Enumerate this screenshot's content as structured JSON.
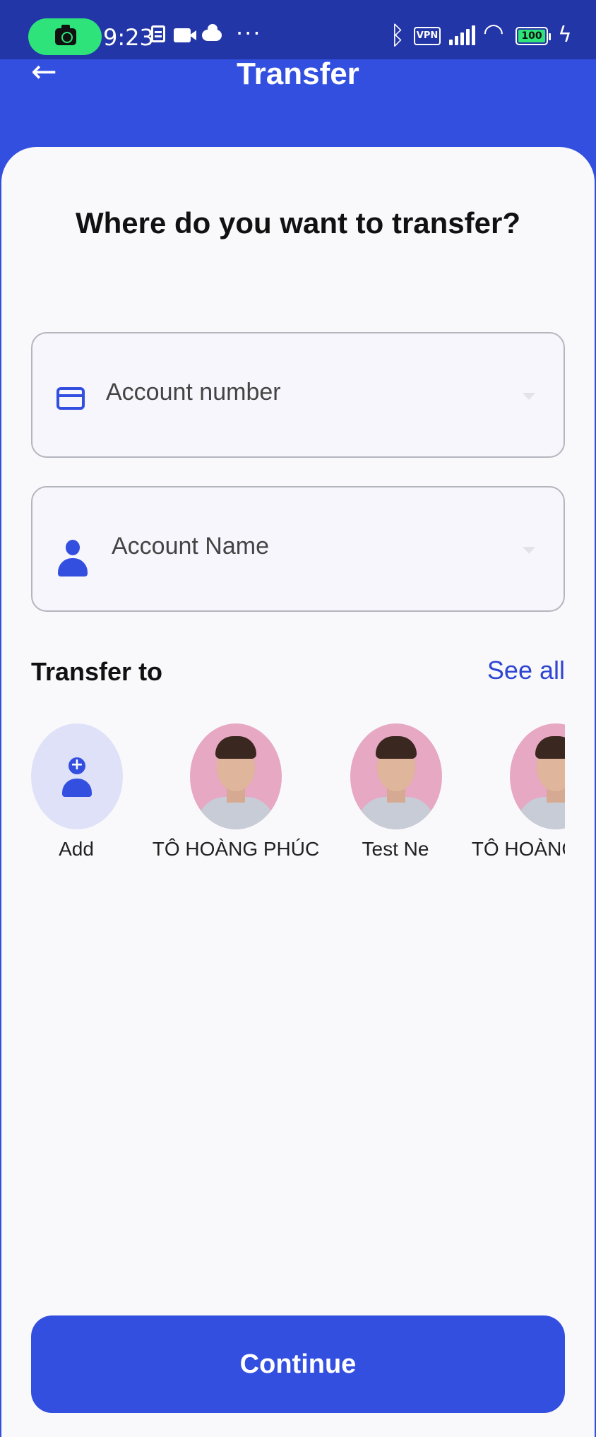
{
  "status_bar": {
    "time": "9:23",
    "more": "···",
    "vpn": "VPN",
    "battery": "100",
    "icons": [
      "screen-record-icon",
      "document-icon",
      "video-icon",
      "cloud-icon",
      "bluetooth-icon",
      "vpn-icon",
      "signal-icon",
      "wifi-icon",
      "battery-icon",
      "charging-icon"
    ]
  },
  "app_bar": {
    "title": "Transfer",
    "back_icon": "arrow-left-icon"
  },
  "form": {
    "question": "Where do you want to transfer?",
    "account_number": {
      "placeholder": "Account number",
      "icon": "credit-card-icon"
    },
    "account_name": {
      "placeholder": "Account Name",
      "icon": "person-icon"
    }
  },
  "recipients": {
    "title": "Transfer to",
    "see_all": "See all",
    "items": [
      {
        "name": "Add",
        "type": "add"
      },
      {
        "name": "TÔ HOÀNG PHÚC",
        "type": "photo"
      },
      {
        "name": "Test Ne",
        "type": "photo"
      },
      {
        "name": "TÔ HOÀNG PHÚC",
        "type": "photo"
      }
    ]
  },
  "actions": {
    "continue": "Continue"
  },
  "colors": {
    "primary": "#334fe0",
    "status_bar": "#2336a7",
    "link": "#2f46d2",
    "background": "#f9f9fb",
    "add_avatar_bg": "#dfe1f8",
    "photo_bg": "#e6a8c3"
  }
}
